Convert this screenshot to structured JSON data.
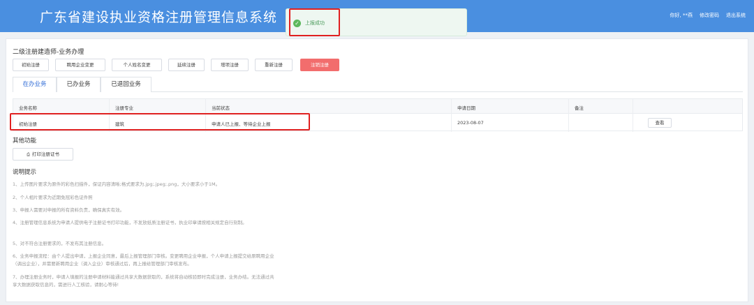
{
  "header": {
    "title": "广东省建设执业资格注册管理信息系统",
    "greeting": "你好, **燕",
    "change_password": "修改密码",
    "logout": "退出系统"
  },
  "toast": {
    "message": "上报成功",
    "icon": "success-check-icon"
  },
  "section_title": "二级注册建造师-业务办理",
  "actions": [
    "初始注册",
    "聘用企业变更",
    "个人姓名变更",
    "延续注册",
    "增项注册",
    "重新注册",
    "注销注册"
  ],
  "tabs": [
    "在办业务",
    "已办业务",
    "已退回业务"
  ],
  "table": {
    "headers": [
      "业务名称",
      "注册专业",
      "当前状态",
      "申请日期",
      "备注",
      ""
    ],
    "rows": [
      {
        "name": "初始注册",
        "major": "建筑",
        "status": "申请人已上报、等待企业上报",
        "date": "2023-08-07",
        "remark": "",
        "action": "查看"
      }
    ]
  },
  "other_functions": {
    "title": "其他功能",
    "print_button": "打印注册证书"
  },
  "notes": {
    "title": "说明提示",
    "items": [
      "1、上传图片要求为原件的彩色扫描件，保证内容清晰;格式要求为.jpg;.jpeg;.png，大小要求小于1M。",
      "2、个人相片要求为近期免冠彩色证件照",
      "3、申报人需要对申报的所有资料负责，确保真实有效。",
      "4、注册管理信息系统为申请人提供电子注册证书打印功能，不发放纸质注册证书，执业印章请按相关规定自行刻制。",
      "5、对不符合注册要求的，不发布其注册信息。",
      "6、业务申报流程：由个人提出申请，上报企业同意，最后上报管理部门审核。变更聘用企业申报，个人申请上报提交给原聘用企业（调出企业），并需要新聘用企业（调入企业）审核通过后，再上报给管理部门审核发布。",
      "7、办理注册业务时，申请人填报的注册申请材料能通过共享大数据获取的，系统将自动核验即时完成注册，业务办结。无法通过共享大数据获取信息的，需进行人工核验，请耐心等待!"
    ]
  }
}
